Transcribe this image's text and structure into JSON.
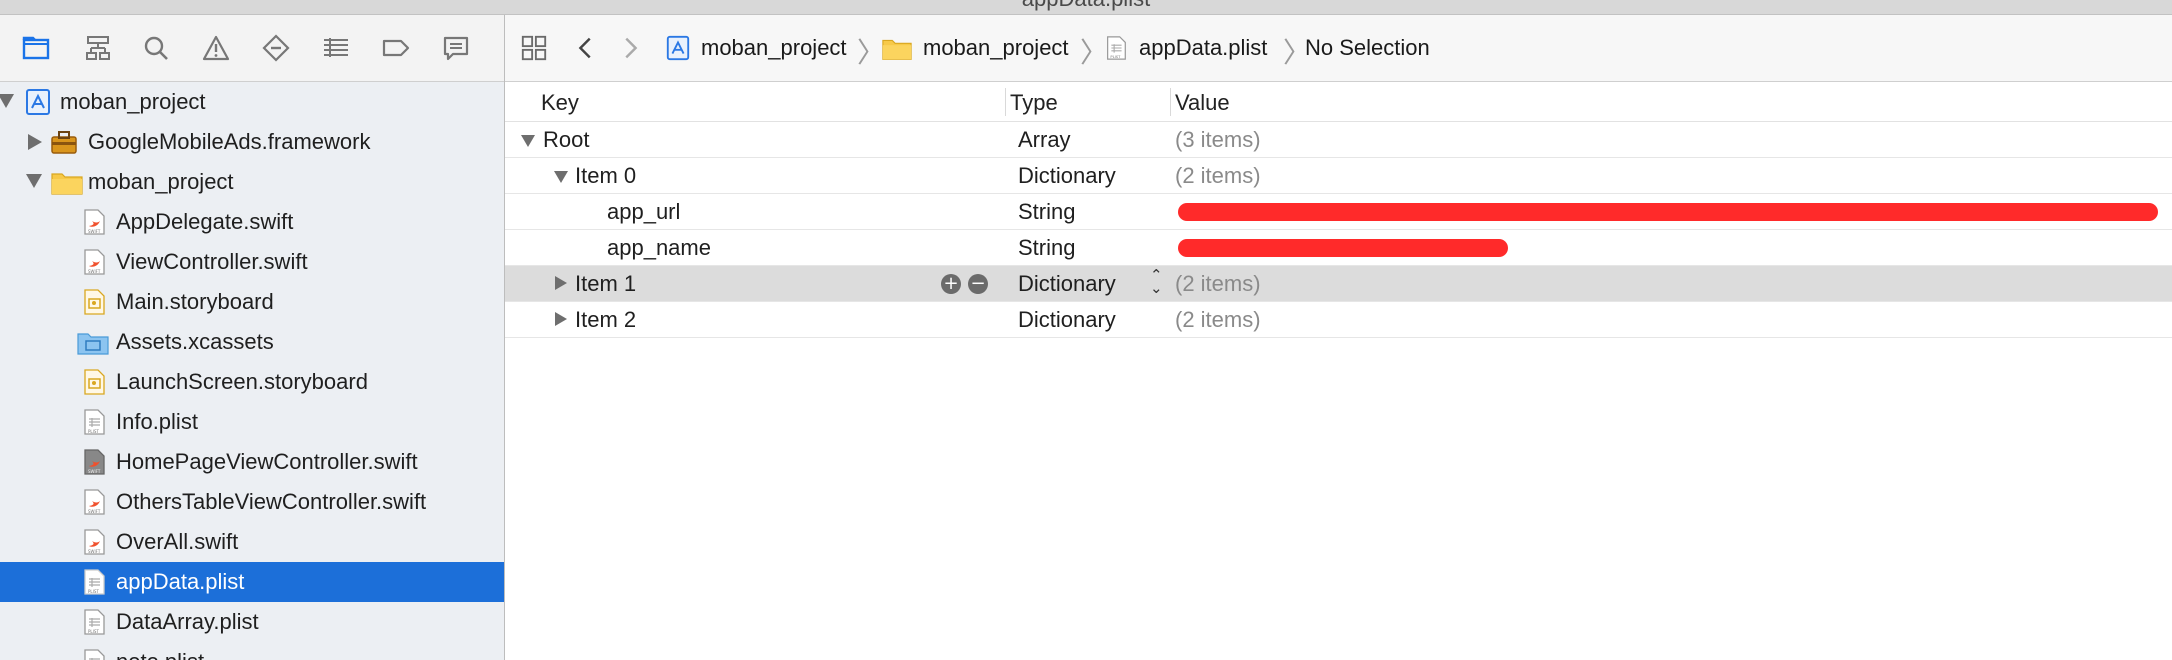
{
  "window": {
    "title": "appData.plist"
  },
  "navigator": {
    "toolbar_icons": [
      "folder-icon",
      "hierarchy-icon",
      "search-icon",
      "warning-icon",
      "test-diamond-icon",
      "debug-list-icon",
      "breakpoint-icon",
      "report-bubble-icon"
    ],
    "items": [
      {
        "label": "moban_project",
        "icon": "xcode-project-icon",
        "disclosure": "open"
      },
      {
        "label": "GoogleMobileAds.framework",
        "icon": "framework-toolbox-icon",
        "disclosure": "closed"
      },
      {
        "label": "moban_project",
        "icon": "yellow-folder-icon",
        "disclosure": "open"
      },
      {
        "label": "AppDelegate.swift",
        "icon": "swift-file-icon"
      },
      {
        "label": "ViewController.swift",
        "icon": "swift-file-icon"
      },
      {
        "label": "Main.storyboard",
        "icon": "storyboard-file-icon"
      },
      {
        "label": "Assets.xcassets",
        "icon": "asset-catalog-icon"
      },
      {
        "label": "LaunchScreen.storyboard",
        "icon": "storyboard-file-icon"
      },
      {
        "label": "Info.plist",
        "icon": "plist-file-icon"
      },
      {
        "label": "HomePageViewController.swift",
        "icon": "swift-file-icon"
      },
      {
        "label": "OthersTableViewController.swift",
        "icon": "swift-file-icon"
      },
      {
        "label": "OverAll.swift",
        "icon": "swift-file-icon"
      },
      {
        "label": "appData.plist",
        "icon": "plist-file-icon",
        "selected": true
      },
      {
        "label": "DataArray.plist",
        "icon": "plist-file-icon"
      },
      {
        "label": "note.plist",
        "icon": "plist-file-icon"
      }
    ]
  },
  "jumpbar": {
    "crumbs": [
      {
        "label": "moban_project",
        "icon": "xcode-project-icon"
      },
      {
        "label": "moban_project",
        "icon": "yellow-folder-icon"
      },
      {
        "label": "appData.plist",
        "icon": "plist-file-icon"
      },
      {
        "label": "No Selection",
        "icon": ""
      }
    ]
  },
  "plist": {
    "headers": {
      "key": "Key",
      "type": "Type",
      "value": "Value"
    },
    "rows": [
      {
        "key": "Root",
        "type": "Array",
        "value": "(3 items)"
      },
      {
        "key": "Item 0",
        "type": "Dictionary",
        "value": "(2 items)"
      },
      {
        "key": "app_url",
        "type": "String",
        "value": ""
      },
      {
        "key": "app_name",
        "type": "String",
        "value": ""
      },
      {
        "key": "Item 1",
        "type": "Dictionary",
        "value": "(2 items)"
      },
      {
        "key": "Item 2",
        "type": "Dictionary",
        "value": "(2 items)"
      }
    ]
  },
  "colors": {
    "selection": "#1c6fd9",
    "accent_blue": "#1a73e8",
    "redaction": "#ff2a2a",
    "folder_yellow": "#f7c948"
  }
}
